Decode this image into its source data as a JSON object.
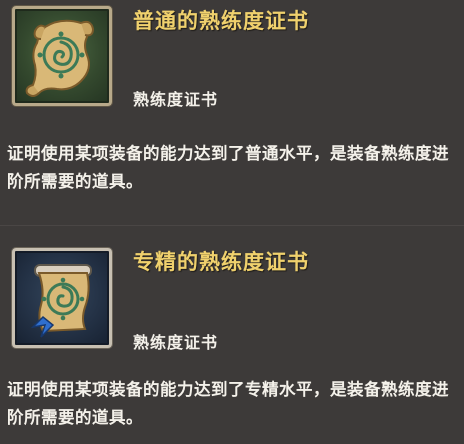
{
  "items": [
    {
      "title": "普通的熟练度证书",
      "category": "熟练度证书",
      "description": "证明使用某项装备的能力达到了普通水平，是装备熟练度进阶所需要的道具。",
      "title_color": "#f0d16d",
      "frame_color": "#b8a98a",
      "icon": "scroll-certificate-icon"
    },
    {
      "title": "专精的熟练度证书",
      "category": "熟练度证书",
      "description": "证明使用某项装备的能力达到了专精水平，是装备熟练度进阶所需要的道具。",
      "title_color": "#f0d16d",
      "frame_color": "#c8c0b2",
      "icon": "scroll-ribbon-certificate-icon"
    }
  ]
}
